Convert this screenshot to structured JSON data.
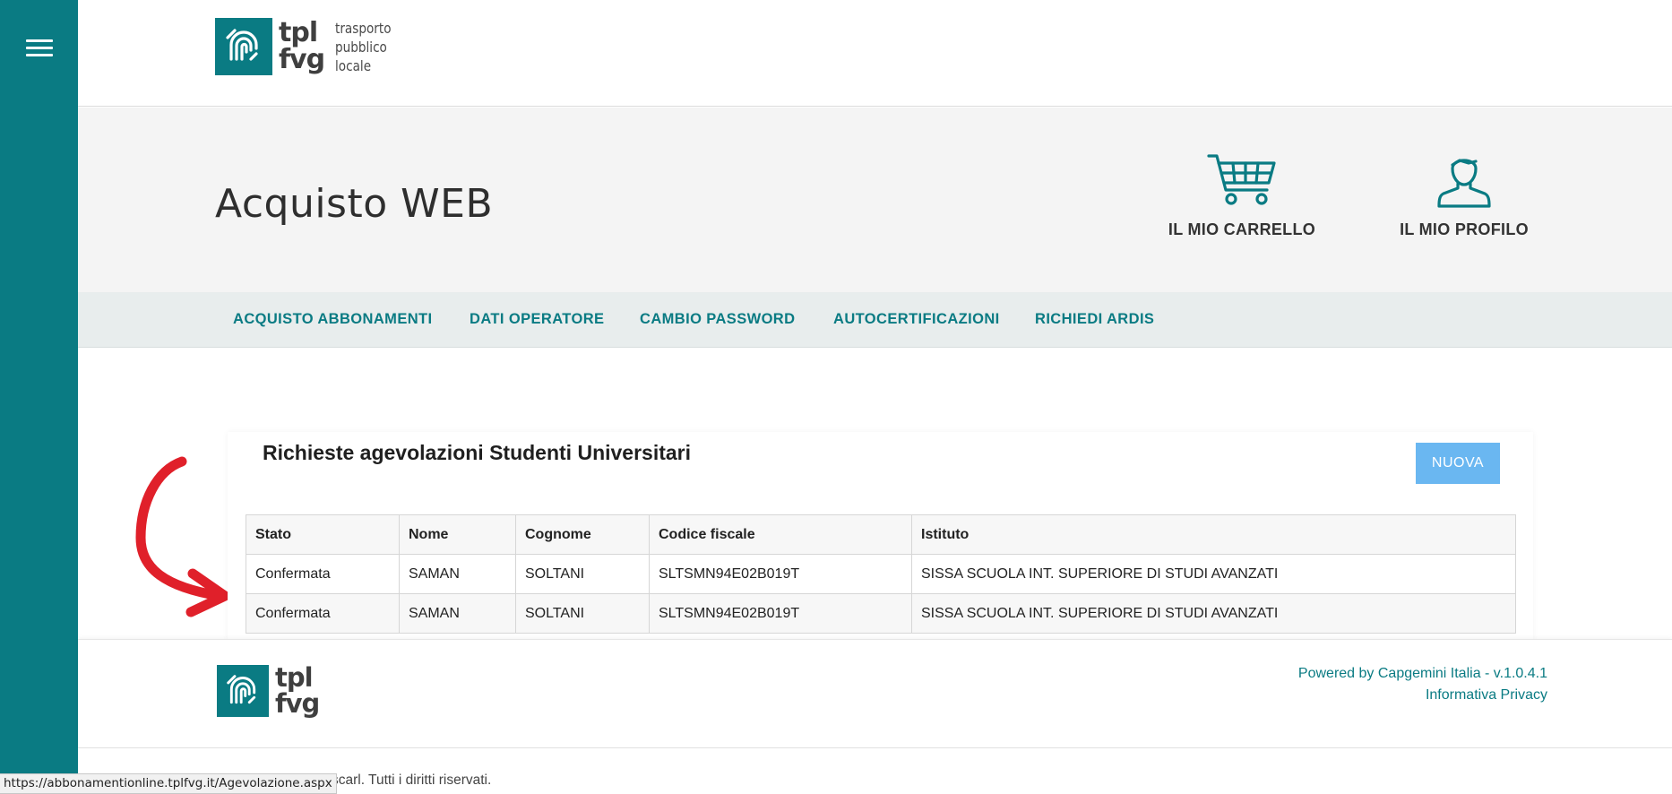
{
  "logo": {
    "word_line1": "tpl",
    "word_line2": "fvg",
    "sub_line1": "trasporto",
    "sub_line2": "pubblico",
    "sub_line3": "locale"
  },
  "header": {
    "title": "Acquisto WEB",
    "cart_label": "IL MIO CARRELLO",
    "profile_label": "IL MIO PROFILO"
  },
  "nav": {
    "items": [
      {
        "label": "ACQUISTO ABBONAMENTI"
      },
      {
        "label": "DATI OPERATORE"
      },
      {
        "label": "CAMBIO PASSWORD"
      },
      {
        "label": "AUTOCERTIFICAZIONI"
      },
      {
        "label": "RICHIEDI ARDIS"
      }
    ]
  },
  "main": {
    "section_title": "Richieste agevolazioni Studenti Universitari",
    "new_button": "NUOVA",
    "table": {
      "columns": [
        "Stato",
        "Nome",
        "Cognome",
        "Codice fiscale",
        "Istituto"
      ],
      "rows": [
        [
          "Confermata",
          "SAMAN",
          "SOLTANI",
          "SLTSMN94E02B019T",
          "SISSA SCUOLA INT. SUPERIORE DI STUDI AVANZATI"
        ],
        [
          "Confermata",
          "SAMAN",
          "SOLTANI",
          "SLTSMN94E02B019T",
          "SISSA SCUOLA INT. SUPERIORE DI STUDI AVANZATI"
        ]
      ]
    }
  },
  "footer": {
    "powered_by": "Powered by Capgemini Italia - v.1.0.4.1",
    "privacy": "Informativa Privacy",
    "copyright_visible": "scarl. Tutti i diritti riservati."
  },
  "status_url": "https://abbonamentionline.tplfvg.it/Agevolazione.aspx",
  "colors": {
    "brand_teal": "#0a7b83",
    "button_blue": "#6ab7f1",
    "annotation_red": "#e0202a"
  },
  "icons": [
    "menu-icon",
    "cart-icon",
    "user-icon"
  ]
}
